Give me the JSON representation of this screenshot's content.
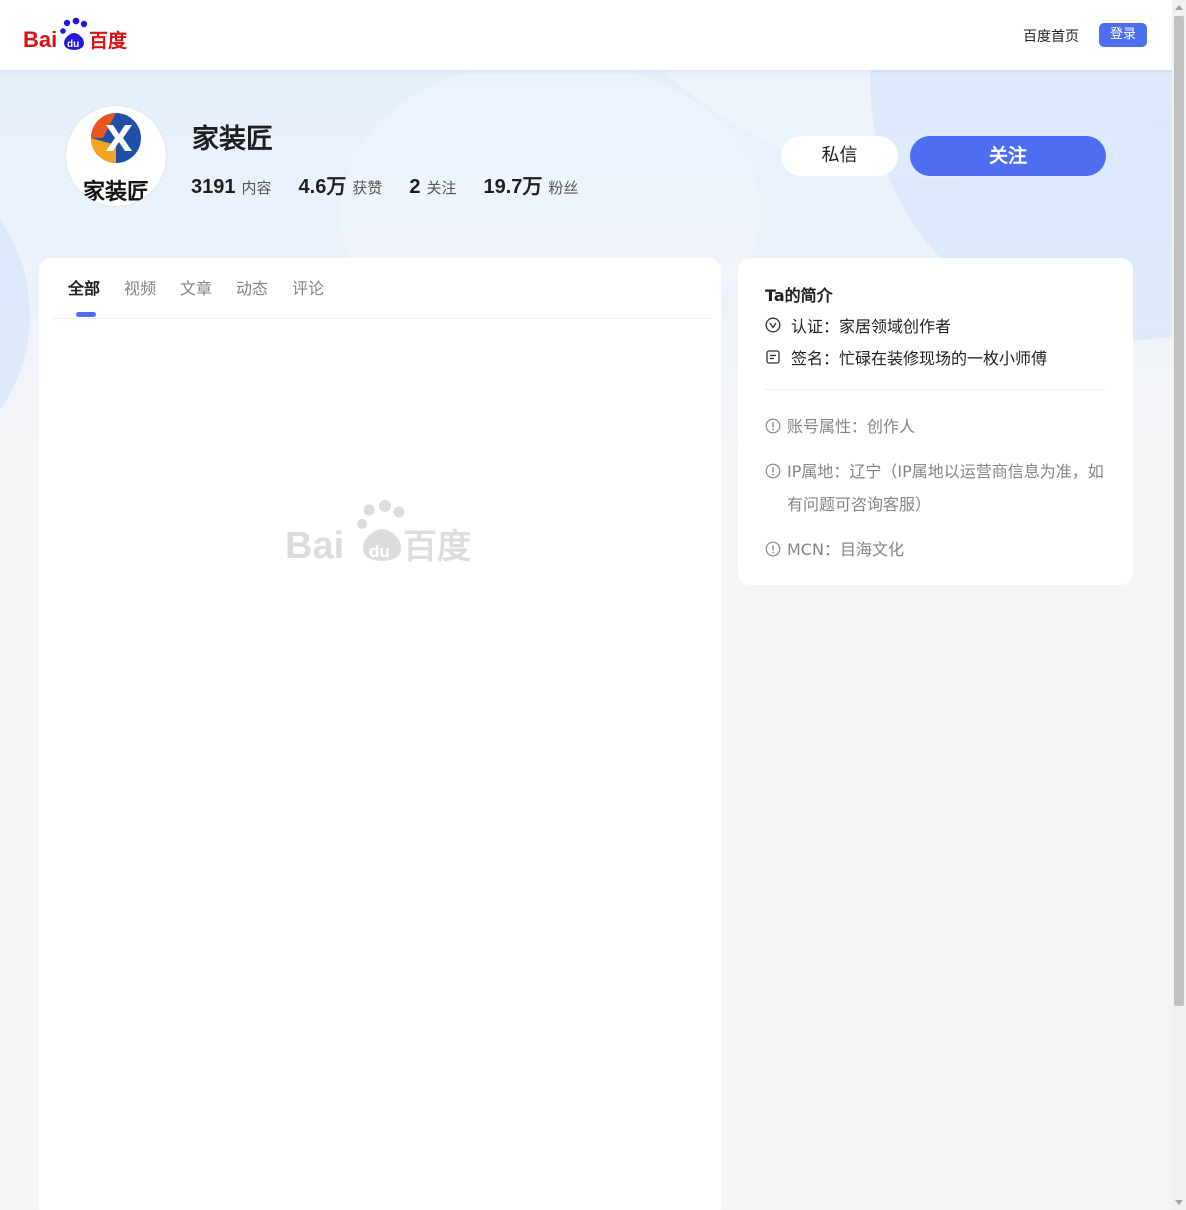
{
  "header": {
    "logo_text": "Bai du 百度",
    "home_link": "百度首页",
    "login_button": "登录"
  },
  "profile": {
    "avatar_text": "家装匠",
    "name": "家装匠",
    "stats": [
      {
        "value": "3191",
        "label": "内容"
      },
      {
        "value": "4.6万",
        "label": "获赞"
      },
      {
        "value": "2",
        "label": "关注"
      },
      {
        "value": "19.7万",
        "label": "粉丝"
      }
    ],
    "message_button": "私信",
    "follow_button": "关注"
  },
  "tabs": [
    {
      "label": "全部",
      "active": true
    },
    {
      "label": "视频",
      "active": false
    },
    {
      "label": "文章",
      "active": false
    },
    {
      "label": "动态",
      "active": false
    },
    {
      "label": "评论",
      "active": false
    }
  ],
  "intro": {
    "title": "Ta的简介",
    "certification": "认证：家居领域创作者",
    "signature": "签名：忙碌在装修现场的一枚小师傅",
    "account_type": "账号属性：创作人",
    "ip_location": "IP属地：辽宁（IP属地以运营商信息为准，如有问题可咨询客服）",
    "mcn": "MCN：目海文化"
  },
  "colors": {
    "accent": "#4e6ef2",
    "baidu_red": "#de0f17",
    "baidu_blue": "#2319dc"
  }
}
